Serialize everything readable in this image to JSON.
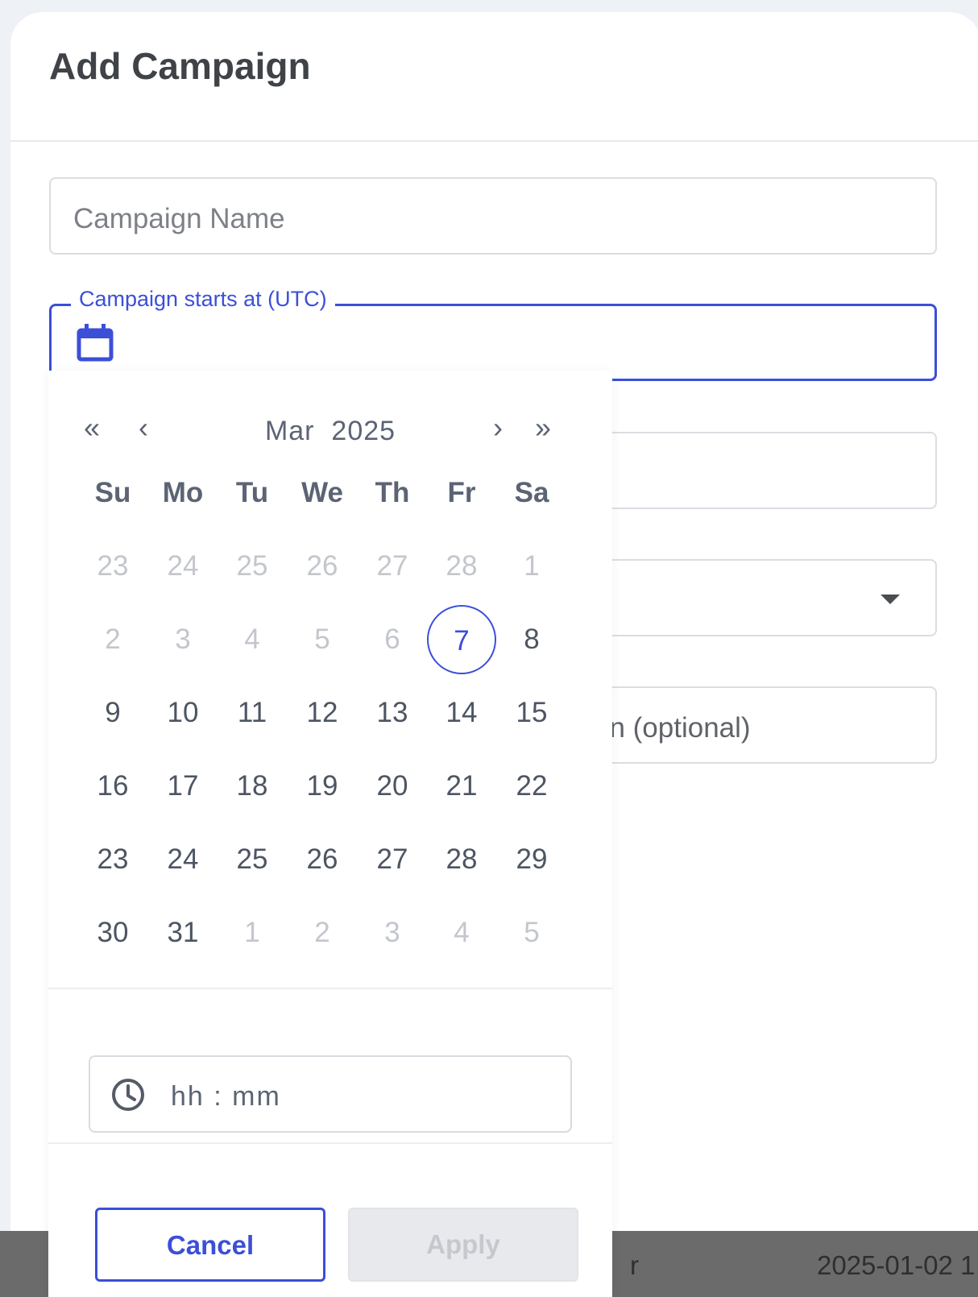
{
  "background": {
    "row_text_left": "r",
    "row_text_right": "2025-01-02 1"
  },
  "modal": {
    "title": "Add Campaign",
    "fields": {
      "campaign_name_placeholder": "Campaign Name",
      "start_label": "Campaign starts at (UTC)",
      "description_placeholder_visible": "on (optional)"
    }
  },
  "picker": {
    "nav": {
      "prev_year": "«",
      "prev_month": "‹",
      "next_month": "›",
      "next_year": "»"
    },
    "month": "Mar",
    "year": "2025",
    "weekdays": [
      "Su",
      "Mo",
      "Tu",
      "We",
      "Th",
      "Fr",
      "Sa"
    ],
    "weeks": [
      [
        "23",
        "24",
        "25",
        "26",
        "27",
        "28",
        "1"
      ],
      [
        "2",
        "3",
        "4",
        "5",
        "6",
        "7",
        "8"
      ],
      [
        "9",
        "10",
        "11",
        "12",
        "13",
        "14",
        "15"
      ],
      [
        "16",
        "17",
        "18",
        "19",
        "20",
        "21",
        "22"
      ],
      [
        "23",
        "24",
        "25",
        "26",
        "27",
        "28",
        "29"
      ],
      [
        "30",
        "31",
        "1",
        "2",
        "3",
        "4",
        "5"
      ]
    ],
    "muted": [
      [
        true,
        true,
        true,
        true,
        true,
        true,
        true
      ],
      [
        true,
        true,
        true,
        true,
        true,
        false,
        false
      ],
      [
        false,
        false,
        false,
        false,
        false,
        false,
        false
      ],
      [
        false,
        false,
        false,
        false,
        false,
        false,
        false
      ],
      [
        false,
        false,
        false,
        false,
        false,
        false,
        false
      ],
      [
        false,
        false,
        true,
        true,
        true,
        true,
        true
      ]
    ],
    "selected_day": "7",
    "time_placeholder": "hh : mm",
    "cancel_label": "Cancel",
    "apply_label": "Apply"
  },
  "colors": {
    "accent": "#3b4fd8",
    "muted_day": "#c3c6cc"
  },
  "icons": {
    "start_field": "calendar-icon",
    "time_field": "clock-icon",
    "select": "caret-down-icon"
  }
}
